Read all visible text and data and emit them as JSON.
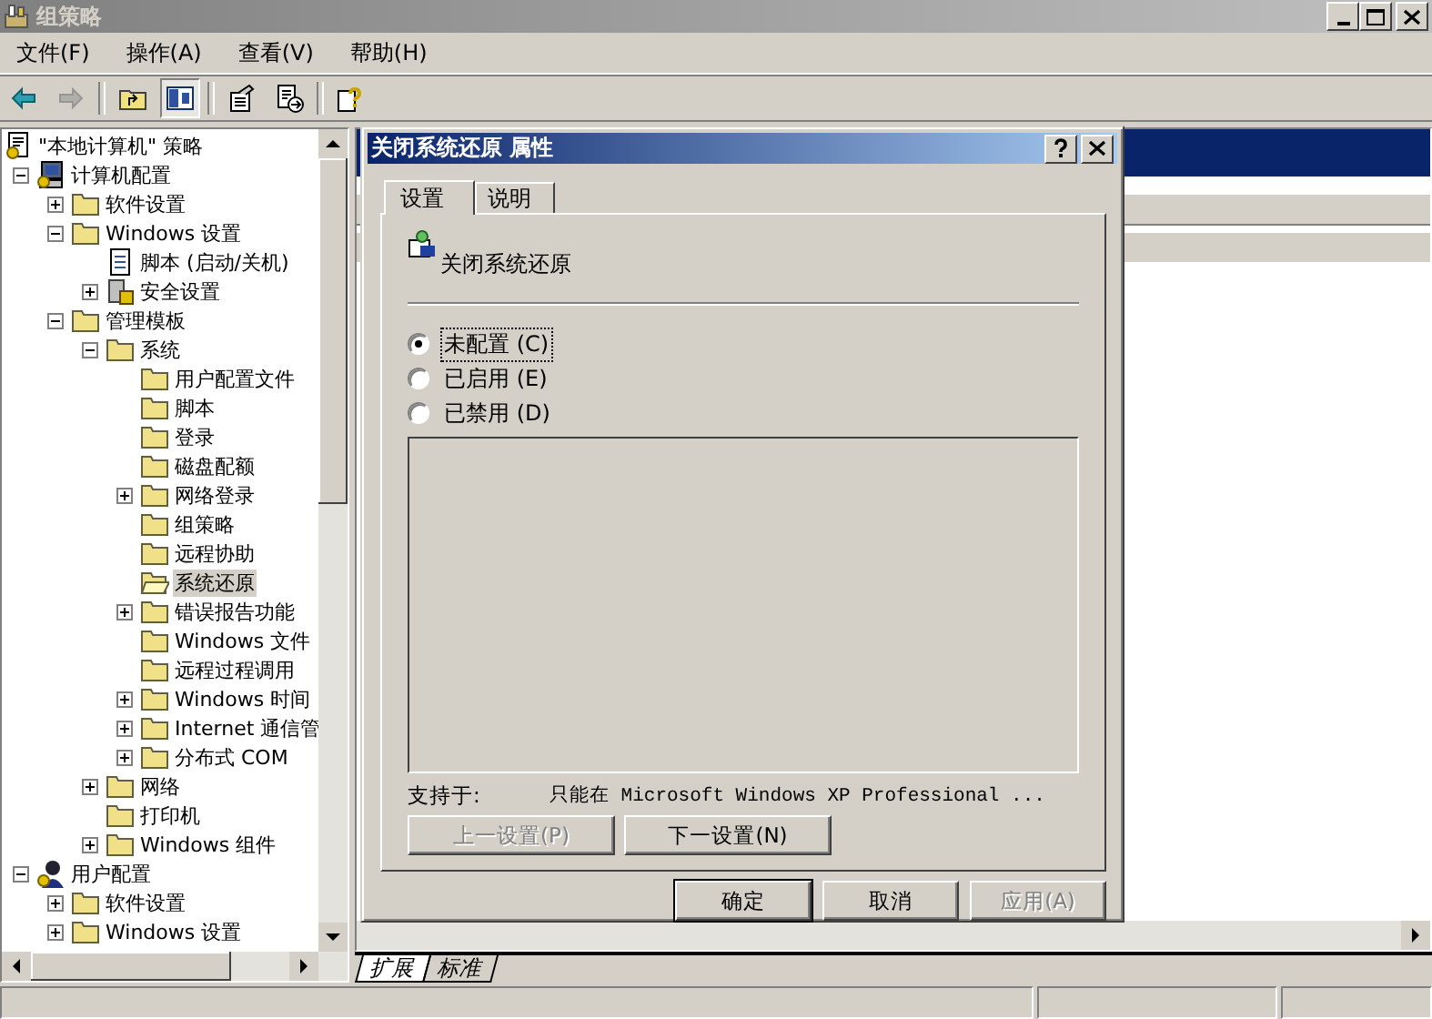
{
  "window": {
    "title": "组策略"
  },
  "menu": [
    {
      "label": "文件(F)"
    },
    {
      "label": "操作(A)"
    },
    {
      "label": "查看(V)"
    },
    {
      "label": "帮助(H)"
    }
  ],
  "toolbar": [
    {
      "kind": "back",
      "disabled": false,
      "pressed": false
    },
    {
      "kind": "forward",
      "disabled": true,
      "pressed": false
    },
    {
      "kind": "sep"
    },
    {
      "kind": "up",
      "disabled": false,
      "pressed": false
    },
    {
      "kind": "tree",
      "disabled": false,
      "pressed": true
    },
    {
      "kind": "sep"
    },
    {
      "kind": "properties",
      "disabled": false,
      "pressed": false
    },
    {
      "kind": "export",
      "disabled": false,
      "pressed": false
    },
    {
      "kind": "sep"
    },
    {
      "kind": "help",
      "disabled": false,
      "pressed": false
    }
  ],
  "tree": [
    {
      "label": "\"本地计算机\" 策略",
      "kind": "policy",
      "selected": false,
      "children": [
        {
          "label": "计算机配置",
          "kind": "computer",
          "expanded": true,
          "selected": false,
          "children": [
            {
              "label": "软件设置",
              "kind": "folder",
              "expanded": false,
              "selected": false
            },
            {
              "label": "Windows 设置",
              "kind": "folder",
              "expanded": true,
              "selected": false,
              "children": [
                {
                  "label": "脚本 (启动/关机)",
                  "kind": "script",
                  "selected": false
                },
                {
                  "label": "安全设置",
                  "kind": "security",
                  "expanded": false,
                  "selected": false
                }
              ]
            },
            {
              "label": "管理模板",
              "kind": "folder",
              "expanded": true,
              "selected": false,
              "children": [
                {
                  "label": "系统",
                  "kind": "folder",
                  "expanded": true,
                  "selected": false,
                  "children": [
                    {
                      "label": "用户配置文件",
                      "kind": "folder",
                      "selected": false
                    },
                    {
                      "label": "脚本",
                      "kind": "folder",
                      "selected": false
                    },
                    {
                      "label": "登录",
                      "kind": "folder",
                      "selected": false
                    },
                    {
                      "label": "磁盘配额",
                      "kind": "folder",
                      "selected": false
                    },
                    {
                      "label": "网络登录",
                      "kind": "folder",
                      "expanded": false,
                      "selected": false
                    },
                    {
                      "label": "组策略",
                      "kind": "folder",
                      "selected": false
                    },
                    {
                      "label": "远程协助",
                      "kind": "folder",
                      "selected": false
                    },
                    {
                      "label": "系统还原",
                      "kind": "folder",
                      "selected": true
                    },
                    {
                      "label": "错误报告功能",
                      "kind": "folder",
                      "expanded": false,
                      "selected": false
                    },
                    {
                      "label": "Windows 文件",
                      "kind": "folder",
                      "selected": false
                    },
                    {
                      "label": "远程过程调用",
                      "kind": "folder",
                      "selected": false
                    },
                    {
                      "label": "Windows 时间",
                      "kind": "folder",
                      "expanded": false,
                      "selected": false
                    },
                    {
                      "label": "Internet 通信管",
                      "kind": "folder",
                      "expanded": false,
                      "selected": false
                    },
                    {
                      "label": "分布式 COM",
                      "kind": "folder",
                      "expanded": false,
                      "selected": false
                    }
                  ]
                },
                {
                  "label": "网络",
                  "kind": "folder",
                  "expanded": false,
                  "selected": false
                },
                {
                  "label": "打印机",
                  "kind": "folder",
                  "selected": false
                },
                {
                  "label": "Windows 组件",
                  "kind": "folder",
                  "expanded": false,
                  "selected": false
                }
              ]
            }
          ]
        },
        {
          "label": "用户配置",
          "kind": "user",
          "expanded": true,
          "selected": false,
          "children": [
            {
              "label": "软件设置",
              "kind": "folder",
              "expanded": false,
              "selected": false
            },
            {
              "label": "Windows 设置",
              "kind": "folder",
              "expanded": false,
              "selected": false
            }
          ]
        }
      ]
    }
  ],
  "dialog": {
    "title": "关闭系统还原 属性",
    "tabs": [
      {
        "label": "设置",
        "selected": true
      },
      {
        "label": "说明",
        "selected": false
      }
    ],
    "setting_title": "关闭系统还原",
    "options": [
      {
        "label": "未配置 (C)",
        "selected": true
      },
      {
        "label": "已启用 (E)",
        "selected": false
      },
      {
        "label": "已禁用 (D)",
        "selected": false
      }
    ],
    "supported_label": "支持于:",
    "supported_value": "只能在 Microsoft Windows XP Professional ...",
    "nav_buttons": [
      {
        "label": "上一设置(P)",
        "disabled": true
      },
      {
        "label": "下一设置(N)",
        "disabled": false
      }
    ],
    "buttons": [
      {
        "label": "确定",
        "disabled": false,
        "default": true
      },
      {
        "label": "取消",
        "disabled": false,
        "default": false
      },
      {
        "label": "应用(A)",
        "disabled": true,
        "default": false
      }
    ]
  },
  "bottom_tabs": [
    {
      "label": "扩展",
      "selected": true
    },
    {
      "label": "标准",
      "selected": false
    }
  ]
}
